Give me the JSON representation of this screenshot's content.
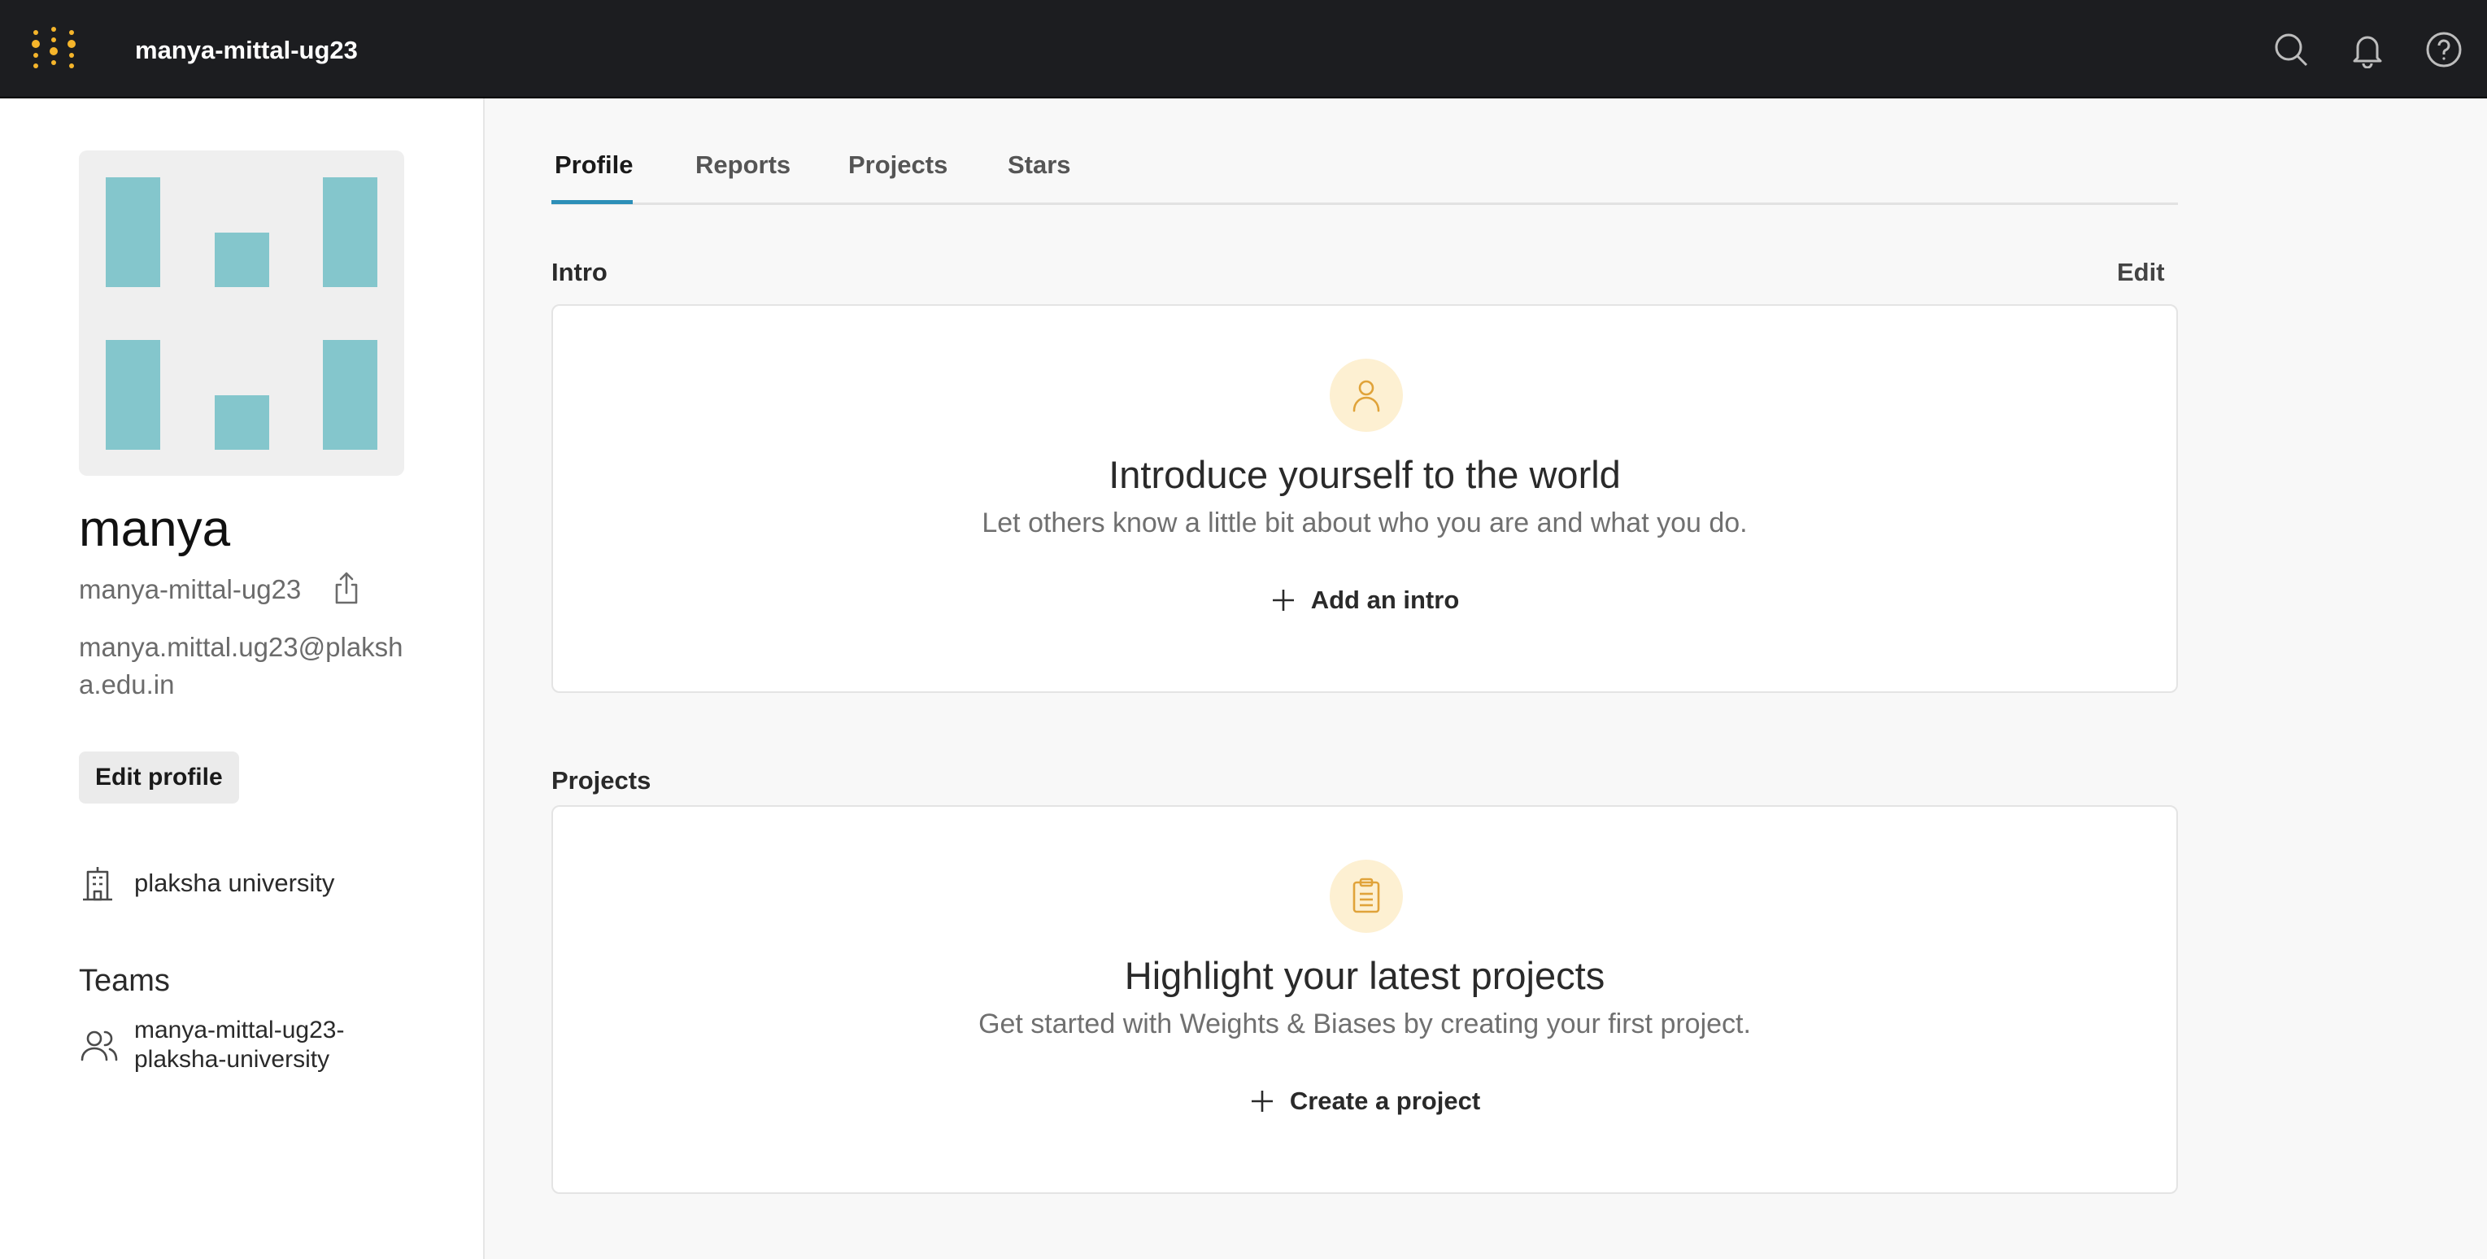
{
  "topbar": {
    "title": "manya-mittal-ug23",
    "icons": [
      "search-icon",
      "bell-icon",
      "help-icon"
    ]
  },
  "profile": {
    "display_name": "manya",
    "username": "manya-mittal-ug23",
    "email": "manya.mittal.ug23@plaksha.edu.in",
    "edit_profile_label": "Edit profile",
    "organization": "plaksha university",
    "teams_heading": "Teams",
    "teams": [
      "manya-mittal-ug23-plaksha-university"
    ]
  },
  "tabs": [
    {
      "label": "Profile",
      "active": true
    },
    {
      "label": "Reports",
      "active": false
    },
    {
      "label": "Projects",
      "active": false
    },
    {
      "label": "Stars",
      "active": false
    }
  ],
  "intro": {
    "section_label": "Intro",
    "edit_label": "Edit",
    "title": "Introduce yourself to the world",
    "subtitle": "Let others know a little bit about who you are and what you do.",
    "action_label": "Add an intro"
  },
  "projects": {
    "section_label": "Projects",
    "title": "Highlight your latest projects",
    "subtitle": "Get started with Weights & Biases by creating your first project.",
    "action_label": "Create a project"
  },
  "colors": {
    "topbar_bg": "#1c1d20",
    "logo_dots": "#f5b52b",
    "avatar_blocks": "#84c6cc",
    "tab_accent": "#2d8fb8",
    "badge_bg": "#fdf0d2",
    "badge_icon": "#e0a33a"
  }
}
